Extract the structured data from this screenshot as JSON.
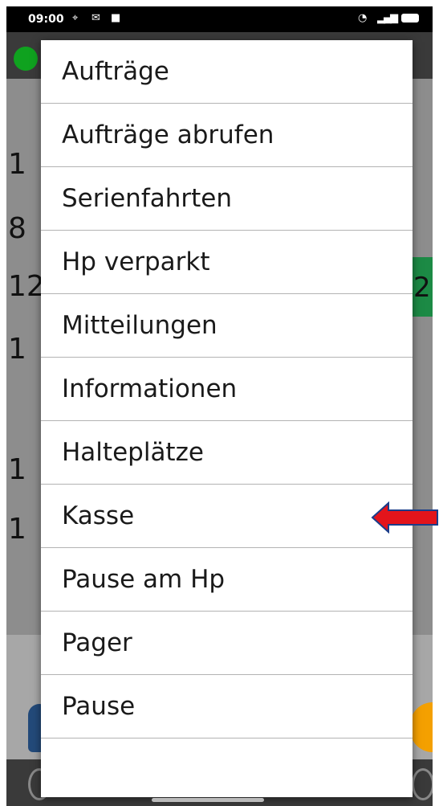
{
  "status_bar": {
    "time": "09:00"
  },
  "background_numbers": [
    "1",
    "8",
    "12",
    "1",
    "1",
    "1"
  ],
  "background_right_number": "2",
  "menu": {
    "items": [
      {
        "label": "Aufträge"
      },
      {
        "label": "Aufträge abrufen"
      },
      {
        "label": "Serienfahrten"
      },
      {
        "label": "Hp verparkt"
      },
      {
        "label": "Mitteilungen"
      },
      {
        "label": "Informationen"
      },
      {
        "label": "Halteplätze"
      },
      {
        "label": "Kasse"
      },
      {
        "label": "Pause am Hp"
      },
      {
        "label": "Pager"
      },
      {
        "label": "Pause"
      },
      {
        "label": ""
      }
    ]
  },
  "annotation": {
    "arrow_color": "#e3141b",
    "points_to": "Kasse"
  },
  "colors": {
    "accent_green": "#0fa21f",
    "menu_bg": "#ffffff",
    "arrow_outline": "#1a3d8a"
  },
  "icons": [
    "location-icon",
    "mail-icon",
    "lock-icon",
    "wifi-icon",
    "signal-icon",
    "battery-icon"
  ]
}
